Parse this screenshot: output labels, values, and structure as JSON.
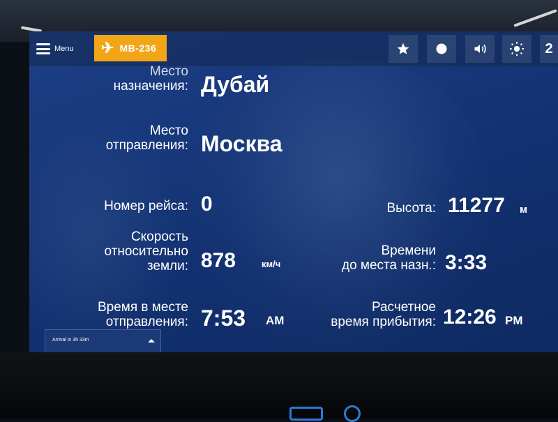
{
  "topbar": {
    "menu_label": "Menu",
    "flight_button_label": "MB-236",
    "icons": [
      "star-icon",
      "circle-icon",
      "volume-icon",
      "brightness-icon",
      "number-icon"
    ],
    "corner_digit": "2"
  },
  "flight_info": {
    "destination_label_line1": "Место",
    "destination_label_line2": "назначения:",
    "destination_value": "Дубай",
    "origin_label_line1": "Место",
    "origin_label_line2": "отправления:",
    "origin_value": "Москва",
    "flight_number_label": "Номер рейса:",
    "flight_number_value": "0",
    "altitude_label": "Высота:",
    "altitude_value": "11277",
    "altitude_unit": "м",
    "ground_speed_label_line1": "Скорость",
    "ground_speed_label_line2": "относительно",
    "ground_speed_label_line3": "земли:",
    "ground_speed_value": "878",
    "ground_speed_unit": "км/ч",
    "time_to_dest_label_line1": "Времени",
    "time_to_dest_label_line2": "до места назн.:",
    "time_to_dest_value": "3:33",
    "origin_time_label_line1": "Время в месте",
    "origin_time_label_line2": "отправления:",
    "origin_time_value": "7:53",
    "origin_time_ampm": "AM",
    "eta_label_line1": "Расчетное",
    "eta_label_line2": "время прибытия:",
    "eta_value": "12:26",
    "eta_ampm": "PM"
  },
  "notification": {
    "text": "Arrival in 3h 33m"
  },
  "colors": {
    "screen_bg": "#17377a",
    "accent": "#f2a516",
    "text": "#ffffff"
  }
}
